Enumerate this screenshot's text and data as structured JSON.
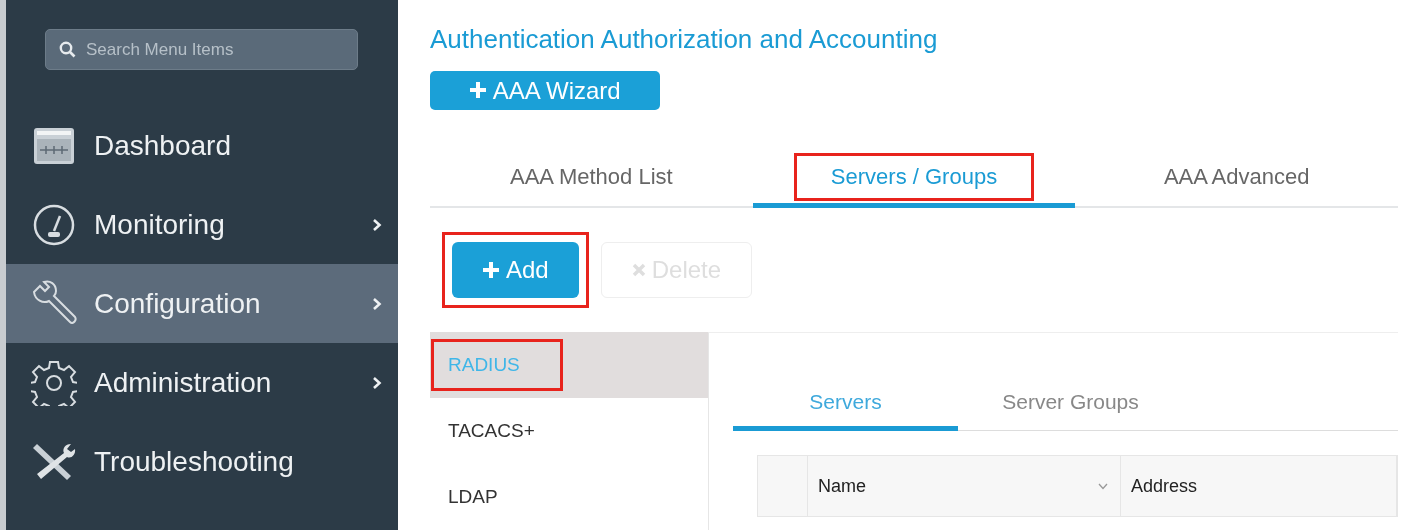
{
  "sidebar": {
    "search": {
      "placeholder": "Search Menu Items"
    },
    "items": [
      {
        "label": "Dashboard",
        "selected": false,
        "has_submenu": false
      },
      {
        "label": "Monitoring",
        "selected": false,
        "has_submenu": true
      },
      {
        "label": "Configuration",
        "selected": true,
        "has_submenu": true
      },
      {
        "label": "Administration",
        "selected": false,
        "has_submenu": true
      },
      {
        "label": "Troubleshooting",
        "selected": false,
        "has_submenu": false
      }
    ]
  },
  "page_title": "Authentication Authorization and Accounting",
  "wizard_button": {
    "label": "AAA Wizard"
  },
  "tabs": [
    {
      "label": "AAA Method List",
      "selected": false,
      "highlighted": false
    },
    {
      "label": "Servers / Groups",
      "selected": true,
      "highlighted": true
    },
    {
      "label": "AAA Advanced",
      "selected": false,
      "highlighted": false
    }
  ],
  "toolbar": [
    {
      "label": "Add",
      "kind": "add",
      "disabled": false,
      "highlighted": true
    },
    {
      "label": "Delete",
      "kind": "delete",
      "disabled": true,
      "highlighted": false
    }
  ],
  "protocols": [
    {
      "label": "RADIUS",
      "selected": true,
      "highlighted": true
    },
    {
      "label": "TACACS+",
      "selected": false,
      "highlighted": false
    },
    {
      "label": "LDAP",
      "selected": false,
      "highlighted": false
    }
  ],
  "sub_tabs": [
    {
      "label": "Servers",
      "selected": true
    },
    {
      "label": "Server Groups",
      "selected": false
    }
  ],
  "table": {
    "columns": [
      {
        "label": "Name",
        "sortable": true
      },
      {
        "label": "Address",
        "sortable": false
      }
    ]
  }
}
